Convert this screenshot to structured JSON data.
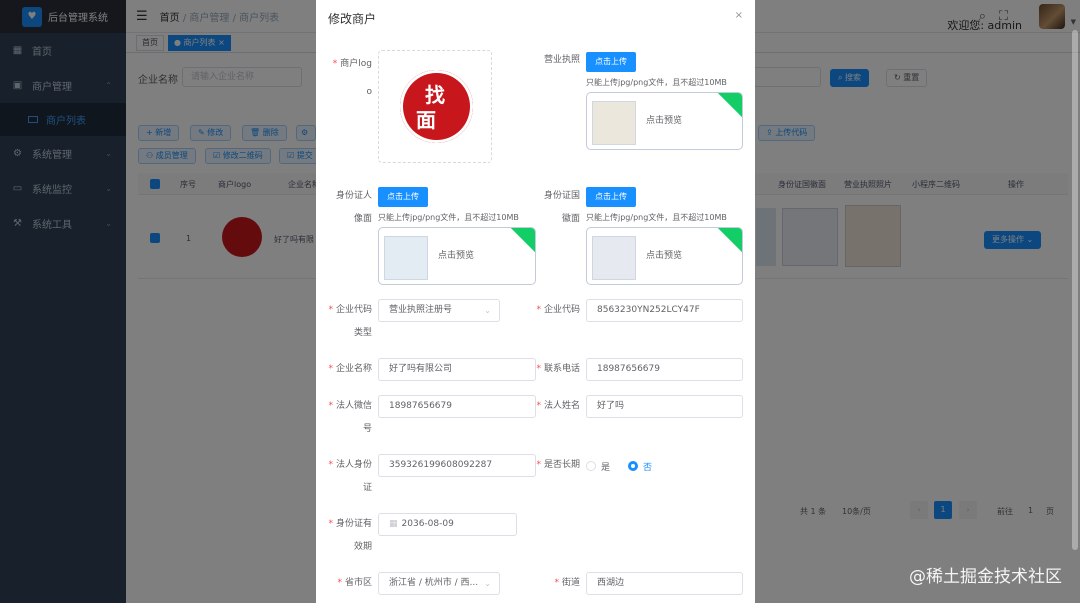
{
  "app": {
    "title": "后台管理系统"
  },
  "sidebar": {
    "items": [
      {
        "label": "首页",
        "icon": "dashboard-icon"
      },
      {
        "label": "商户管理",
        "icon": "shop-icon"
      },
      {
        "label": "商户列表",
        "icon": "list-icon"
      },
      {
        "label": "系统管理",
        "icon": "settings-icon"
      },
      {
        "label": "系统监控",
        "icon": "monitor-icon"
      },
      {
        "label": "系统工具",
        "icon": "tool-icon"
      }
    ]
  },
  "header": {
    "breadcrumb": [
      "首页",
      "商户管理",
      "商户列表"
    ],
    "welcome": "欢迎您: admin"
  },
  "tags": [
    "首页",
    "商户列表"
  ],
  "search": {
    "label": "企业名称",
    "placeholder": "请输入企业名称",
    "search_label": "搜索",
    "reset_label": "重置"
  },
  "toolbar": {
    "add": "新增",
    "edit": "修改",
    "delete": "删除",
    "members": "成员管理",
    "qrcode": "修改二维码",
    "submit": "提交",
    "upload_code": "上传代码"
  },
  "table": {
    "headers": {
      "index": "序号",
      "logo": "商户logo",
      "company": "企业名称",
      "id_back": "身份证国徽面",
      "license": "营业执照照片",
      "mini_qr": "小程序二维码",
      "ops": "操作"
    },
    "row": {
      "index": "1",
      "company": "好了吗有限",
      "more": "更多操作"
    }
  },
  "pagination": {
    "total": "共 1 条",
    "size": "10条/页",
    "page": "1",
    "goto": "前往",
    "goto_page": "1",
    "page_suffix": "页"
  },
  "dialog": {
    "title": "修改商户",
    "close": "×",
    "logo_label": [
      "商户log",
      "o"
    ],
    "license_label": "营业执照",
    "upload_label": "点击上传",
    "hint": "只能上传jpg/png文件，且不超过10MB",
    "preview_label": "点击预览",
    "id_front_label": [
      "身份证人",
      "像面"
    ],
    "id_back_label": [
      "身份证国",
      "徽面"
    ],
    "code_type_label": [
      "企业代码",
      "类型"
    ],
    "code_type_value": "营业执照注册号",
    "code_label": "企业代码",
    "code_value": "8563230YN252LCY47F",
    "company_label": "企业名称",
    "company_value": "好了吗有限公司",
    "phone_label": "联系电话",
    "phone_value": "18987656679",
    "wechat_label": [
      "法人微信",
      "号"
    ],
    "wechat_value": "18987656679",
    "legal_name_label": "法人姓名",
    "legal_name_value": "好了吗",
    "legal_id_label": [
      "法人身份",
      "证"
    ],
    "legal_id_value": "359326199608092287",
    "longterm_label": "是否长期",
    "yes": "是",
    "no": "否",
    "expiry_label": [
      "身份证有",
      "效期"
    ],
    "expiry_value": "2036-08-09",
    "region_label": "省市区",
    "region_value": "浙江省 / 杭州市 / 西...",
    "street_label": "街道",
    "street_value": "西湖边",
    "logo_text": {
      "top": "找",
      "bottom": "面"
    }
  },
  "watermark": "@稀土掘金技术社区",
  "colors": {
    "primary": "#1890ff",
    "sidebar": "#304156",
    "required": "#ff4949",
    "badge": "#13ce66"
  }
}
